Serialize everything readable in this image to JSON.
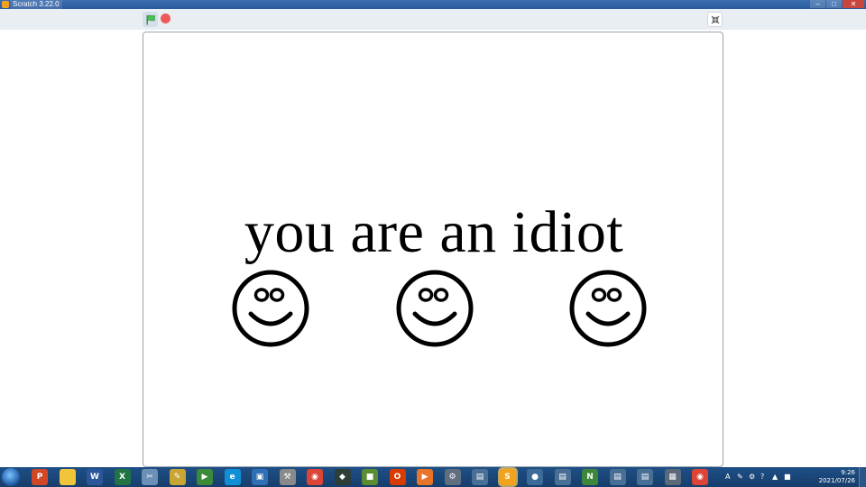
{
  "window": {
    "title": "Scratch 3.22.0",
    "minimize": "–",
    "maximize": "□",
    "close": "✕"
  },
  "stage": {
    "text": "you are an idiot"
  },
  "icons": {
    "flag": "green-flag-icon",
    "stop": "stop-icon",
    "fullscreen": "fullscreen-icon",
    "face": "smiley-face-icon"
  },
  "colors": {
    "flag": "#4cbf56",
    "stop": "#ec5959",
    "taskbar": "#1e4f86"
  },
  "taskbar": {
    "apps": [
      {
        "name": "powerpoint-icon",
        "glyph": "P",
        "color": "#d24726"
      },
      {
        "name": "file-explorer-icon",
        "glyph": "",
        "color": "#f0c53a"
      },
      {
        "name": "word-icon",
        "glyph": "W",
        "color": "#2b579a"
      },
      {
        "name": "excel-icon",
        "glyph": "X",
        "color": "#217346"
      },
      {
        "name": "snipping-tool-icon",
        "glyph": "✂",
        "color": "#6b8fb5"
      },
      {
        "name": "paint-icon",
        "glyph": "✎",
        "color": "#c9a634"
      },
      {
        "name": "media-player-icon",
        "glyph": "▶",
        "color": "#3a8a3a"
      },
      {
        "name": "edge-icon",
        "glyph": "e",
        "color": "#0f8fd6"
      },
      {
        "name": "virtualbox-icon",
        "glyph": "▣",
        "color": "#2f6fb5"
      },
      {
        "name": "tool-icon",
        "glyph": "⚒",
        "color": "#8a8a8a"
      },
      {
        "name": "chrome-icon",
        "glyph": "◉",
        "color": "#db4437"
      },
      {
        "name": "dark-app-icon",
        "glyph": "◆",
        "color": "#2c3e36"
      },
      {
        "name": "minecraft-icon",
        "glyph": "■",
        "color": "#5b8c32"
      },
      {
        "name": "office-icon",
        "glyph": "O",
        "color": "#d83b01"
      },
      {
        "name": "media-icon",
        "glyph": "▶",
        "color": "#e8742a"
      },
      {
        "name": "settings-icon",
        "glyph": "⚙",
        "color": "#5f6f80"
      },
      {
        "name": "window-app-icon",
        "glyph": "▤",
        "color": "#4a6f94"
      },
      {
        "name": "scratch-icon",
        "glyph": "S",
        "color": "#f4a21d"
      },
      {
        "name": "app-icon",
        "glyph": "●",
        "color": "#3c6a99"
      },
      {
        "name": "window-icon-2",
        "glyph": "▤",
        "color": "#4a6f94"
      },
      {
        "name": "nodejs-icon",
        "glyph": "N",
        "color": "#3c873a"
      },
      {
        "name": "window-icon-3",
        "glyph": "▤",
        "color": "#4a6f94"
      },
      {
        "name": "window-icon-4",
        "glyph": "▤",
        "color": "#4a6f94"
      },
      {
        "name": "calculator-icon",
        "glyph": "▦",
        "color": "#5a6a7a"
      },
      {
        "name": "chrome-icon-2",
        "glyph": "◉",
        "color": "#db4437"
      }
    ],
    "tray_glyphs": [
      "A",
      "✎",
      "⚙",
      "?",
      "▲",
      "■"
    ],
    "clock_time": "9:26",
    "clock_date": "2021/07/26"
  }
}
